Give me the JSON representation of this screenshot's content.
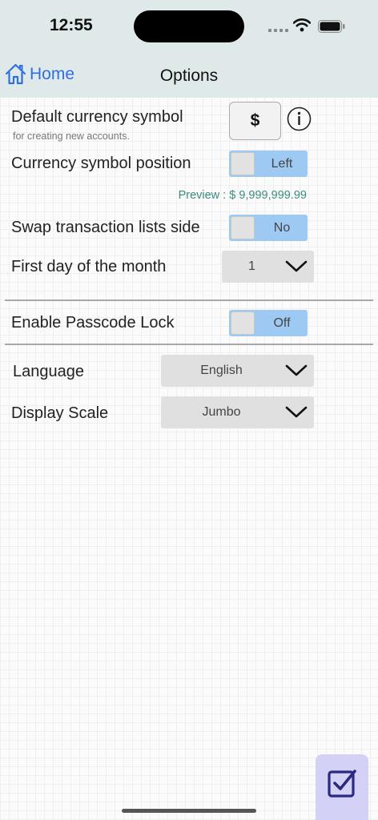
{
  "status_bar": {
    "time": "12:55"
  },
  "nav": {
    "home_label": "Home",
    "title": "Options"
  },
  "currency": {
    "label": "Default currency symbol",
    "sublabel": "for creating new accounts.",
    "symbol": "$"
  },
  "symbol_position": {
    "label": "Currency symbol position",
    "value": "Left"
  },
  "preview": "Preview : $ 9,999,999.99",
  "swap_lists": {
    "label": "Swap transaction lists side",
    "value": "No"
  },
  "first_day": {
    "label": "First day of the month",
    "value": "1"
  },
  "passcode": {
    "label": "Enable Passcode Lock",
    "value": "Off"
  },
  "language": {
    "label": "Language",
    "value": "English"
  },
  "display_scale": {
    "label": "Display Scale",
    "value": "Jumbo"
  },
  "colors": {
    "accent": "#2f6fe0",
    "toggle": "#9ec9f2",
    "preview_text": "#3b8c82",
    "check_button": "#d4d1f7",
    "check_icon": "#2b2a80"
  },
  "icons": {
    "home": "house-icon",
    "info": "info-icon",
    "dropdown": "chevron-down-icon",
    "save": "checkbox-icon"
  }
}
